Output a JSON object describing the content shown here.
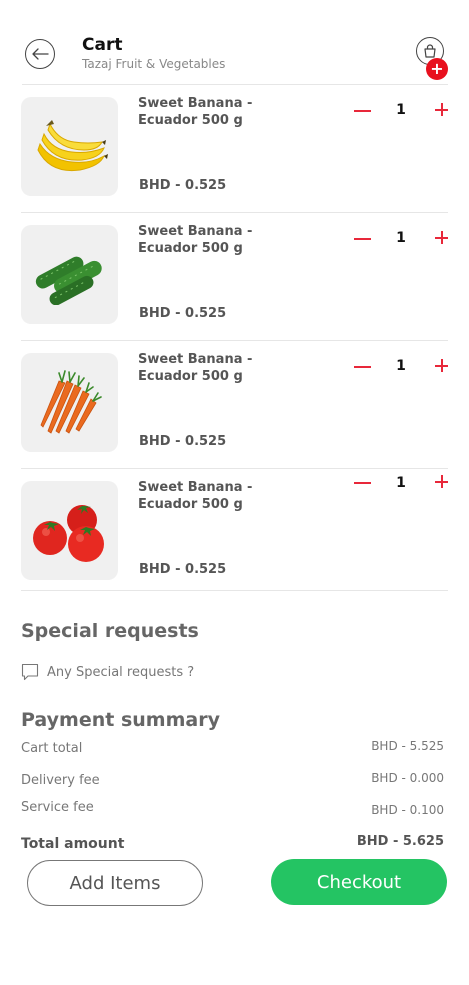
{
  "header": {
    "title": "Cart",
    "subtitle": "Tazaj Fruit & Vegetables",
    "badge": "+"
  },
  "items": [
    {
      "name": "Sweet Banana - Ecuador 500 g",
      "price": "BHD - 0.525",
      "qty": "1",
      "image": "banana"
    },
    {
      "name": "Sweet Banana - Ecuador 500 g",
      "price": "BHD - 0.525",
      "qty": "1",
      "image": "cucumber"
    },
    {
      "name": "Sweet Banana - Ecuador 500 g",
      "price": "BHD - 0.525",
      "qty": "1",
      "image": "carrot"
    },
    {
      "name": "Sweet Banana - Ecuador 500 g",
      "price": "BHD - 0.525",
      "qty": "1",
      "image": "tomato"
    }
  ],
  "special_requests": {
    "title": "Special requests",
    "placeholder": "Any Special requests ?"
  },
  "payment_summary": {
    "title": "Payment summary",
    "rows": [
      {
        "label": "Cart total",
        "value": "BHD - 5.525"
      },
      {
        "label": "Delivery fee",
        "value": "BHD - 0.000"
      },
      {
        "label": "Service fee",
        "value": "BHD - 0.100"
      }
    ],
    "total_label": "Total amount",
    "total_value": "BHD - 5.625"
  },
  "actions": {
    "add_items": "Add Items",
    "checkout": "Checkout"
  },
  "colors": {
    "accent_red": "#e8283a",
    "checkout_green": "#24c463"
  }
}
